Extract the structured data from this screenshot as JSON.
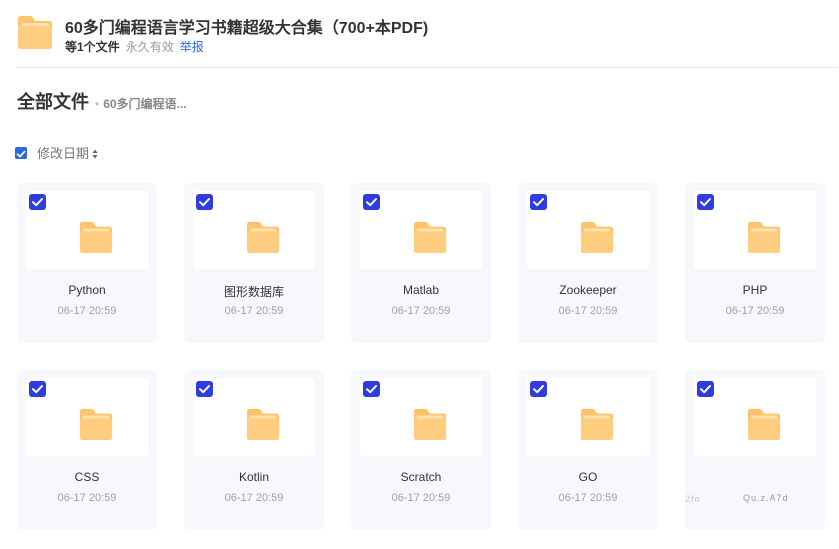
{
  "share": {
    "title": "60多门编程语言学习书籍超级大合集（700+本PDF)",
    "file_count": "等1个文件",
    "validity": "永久有效",
    "report_label": "举报"
  },
  "breadcrumb": {
    "root": "全部文件",
    "current": "60多门编程语..."
  },
  "sort": {
    "label": "修改日期"
  },
  "colors": {
    "accent": "#2b6bd8",
    "checkbox": "#2f3de0",
    "folder": "#ffc46b"
  },
  "files": [
    {
      "name": "Python",
      "date": "06-17 20:59"
    },
    {
      "name": "图形数据库",
      "date": "06-17 20:59"
    },
    {
      "name": "Matlab",
      "date": "06-17 20:59"
    },
    {
      "name": "Zookeeper",
      "date": "06-17 20:59"
    },
    {
      "name": "PHP",
      "date": "06-17 20:59"
    },
    {
      "name": "CSS",
      "date": "06-17 20:59"
    },
    {
      "name": "Kotlin",
      "date": "06-17 20:59"
    },
    {
      "name": "Scratch",
      "date": "06-17 20:59"
    },
    {
      "name": "GO",
      "date": "06-17 20:59"
    },
    {
      "name": "",
      "date": ""
    }
  ],
  "obscured_text": {
    "left": "2fo",
    "right": "Qu.z.A7d"
  }
}
